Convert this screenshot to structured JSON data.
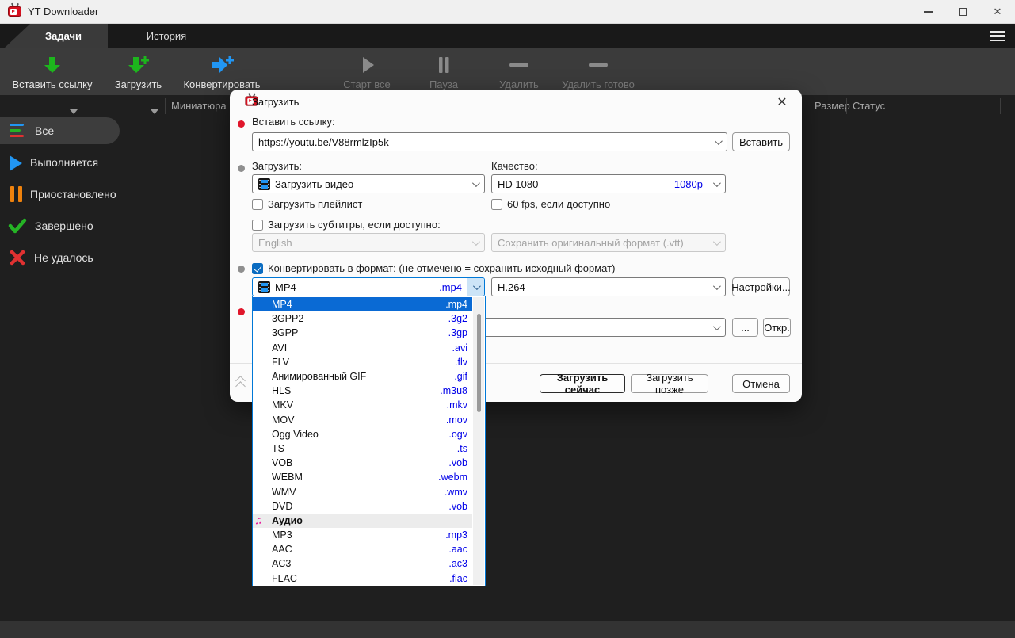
{
  "window": {
    "title": "YT Downloader"
  },
  "tabs": {
    "tasks": "Задачи",
    "history": "История"
  },
  "toolbar": {
    "paste_link": "Вставить ссылку",
    "download": "Загрузить",
    "convert": "Конвертировать",
    "start_all": "Старт все",
    "pause": "Пауза",
    "delete": "Удалить",
    "delete_done": "Удалить готово"
  },
  "list_header": {
    "thumbnail": "Миниатюра",
    "size": "Размер",
    "status": "Статус"
  },
  "sidebar": {
    "items": [
      {
        "label": "Все"
      },
      {
        "label": "Выполняется"
      },
      {
        "label": "Приостановлено"
      },
      {
        "label": "Завершено"
      },
      {
        "label": "Не удалось"
      }
    ]
  },
  "dialog": {
    "title": "Загрузить",
    "paste_link_label": "Вставить ссылку:",
    "url_value": "https://youtu.be/V88rmlzIp5k",
    "paste_button": "Вставить",
    "download_label": "Загрузить:",
    "quality_label": "Качество:",
    "video_option": "Загрузить видео",
    "quality_value": "HD 1080",
    "quality_badge": "1080p",
    "playlist_checkbox": "Загрузить плейлист",
    "fps_checkbox": "60 fps, если доступно",
    "subtitles_checkbox": "Загрузить субтитры, если доступно:",
    "subtitle_lang": "English",
    "subtitle_format": "Сохранить оригинальный формат (.vtt)",
    "convert_checkbox": "Конвертировать в формат: (не отмечено = сохранить исходный формат)",
    "format_value": "MP4",
    "format_ext": ".mp4",
    "codec_value": "H.264",
    "settings_button": "Настройки...",
    "browse_button": "...",
    "open_button": "Откр.",
    "download_now": "Загрузить сейчас",
    "download_later": "Загрузить позже",
    "cancel": "Отмена"
  },
  "format_dropdown": {
    "items": [
      {
        "name": "MP4",
        "ext": ".mp4",
        "selected": true
      },
      {
        "name": "3GPP2",
        "ext": ".3g2"
      },
      {
        "name": "3GPP",
        "ext": ".3gp"
      },
      {
        "name": "AVI",
        "ext": ".avi"
      },
      {
        "name": "FLV",
        "ext": ".flv"
      },
      {
        "name": "Анимированный GIF",
        "ext": ".gif"
      },
      {
        "name": "HLS",
        "ext": ".m3u8"
      },
      {
        "name": "MKV",
        "ext": ".mkv"
      },
      {
        "name": "MOV",
        "ext": ".mov"
      },
      {
        "name": "Ogg Video",
        "ext": ".ogv"
      },
      {
        "name": "TS",
        "ext": ".ts"
      },
      {
        "name": "VOB",
        "ext": ".vob"
      },
      {
        "name": "WEBM",
        "ext": ".webm"
      },
      {
        "name": "WMV",
        "ext": ".wmv"
      },
      {
        "name": "DVD",
        "ext": ".vob"
      },
      {
        "name": "Аудио",
        "header": true
      },
      {
        "name": "MP3",
        "ext": ".mp3"
      },
      {
        "name": "AAC",
        "ext": ".aac"
      },
      {
        "name": "AC3",
        "ext": ".ac3"
      },
      {
        "name": "FLAC",
        "ext": ".flac"
      }
    ]
  },
  "colors": {
    "accent_blue": "#0078d7",
    "extension_blue": "#0000e8",
    "status_red": "#e0162b",
    "status_green": "#25b325",
    "status_orange": "#ef820d",
    "audio_pink": "#e81c9c",
    "brand_red": "#d6101f"
  }
}
